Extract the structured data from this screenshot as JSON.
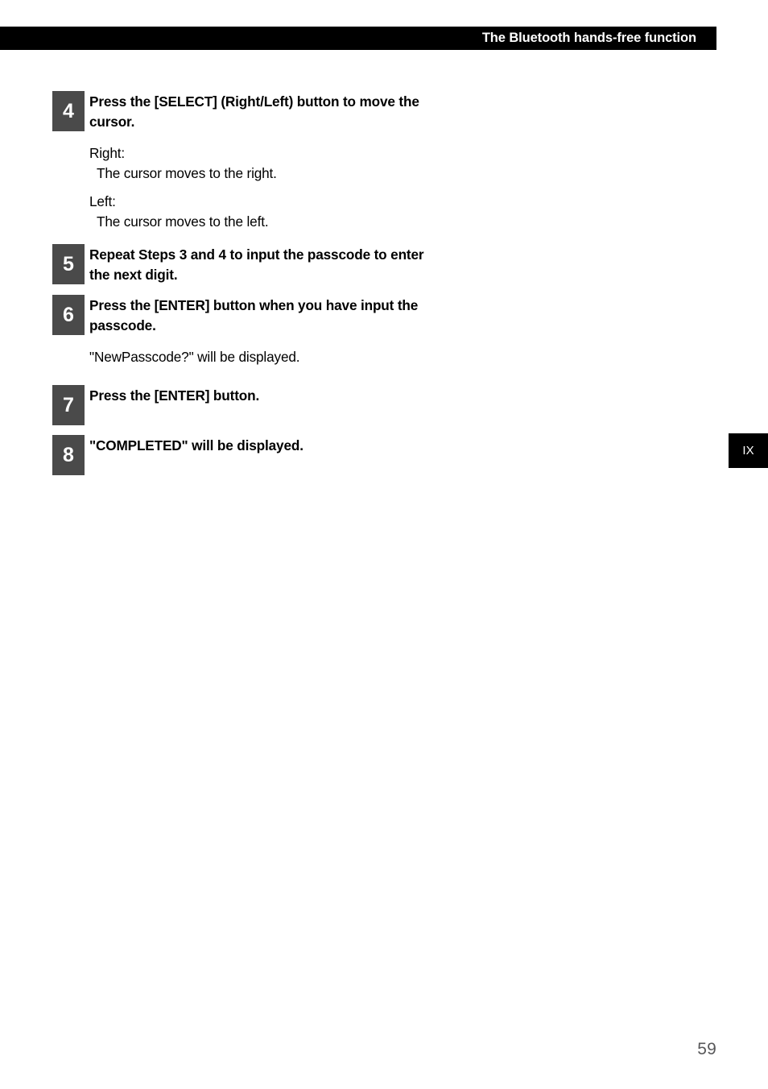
{
  "header": {
    "title": "The Bluetooth hands-free function"
  },
  "steps": [
    {
      "number": "4",
      "title": "Press the [SELECT] (Right/Left) button to move the cursor.",
      "notes": [
        {
          "text": "Right:",
          "indent": false
        },
        {
          "text": "The cursor moves to the right.",
          "indent": true
        },
        {
          "text": "Left:",
          "indent": false
        },
        {
          "text": "The cursor moves to the left.",
          "indent": true
        }
      ]
    },
    {
      "number": "5",
      "title": "Repeat Steps 3 and 4 to input the passcode to enter the next digit.",
      "notes": []
    },
    {
      "number": "6",
      "title": "Press the [ENTER] button when you have input the passcode.",
      "notes": [
        {
          "text": "\"NewPasscode?\" will be displayed.",
          "indent": false
        }
      ]
    },
    {
      "number": "7",
      "title": "Press the [ENTER] button.",
      "notes": []
    },
    {
      "number": "8",
      "title": "\"COMPLETED\" will be displayed.",
      "notes": []
    }
  ],
  "side_tab": {
    "label": "IX"
  },
  "footer": {
    "page_number": "59"
  },
  "colors": {
    "header_bar": "#000000",
    "step_box": "#4a4a4a",
    "text": "#000000",
    "page_number": "#58585a",
    "side_tab": "#000000"
  }
}
